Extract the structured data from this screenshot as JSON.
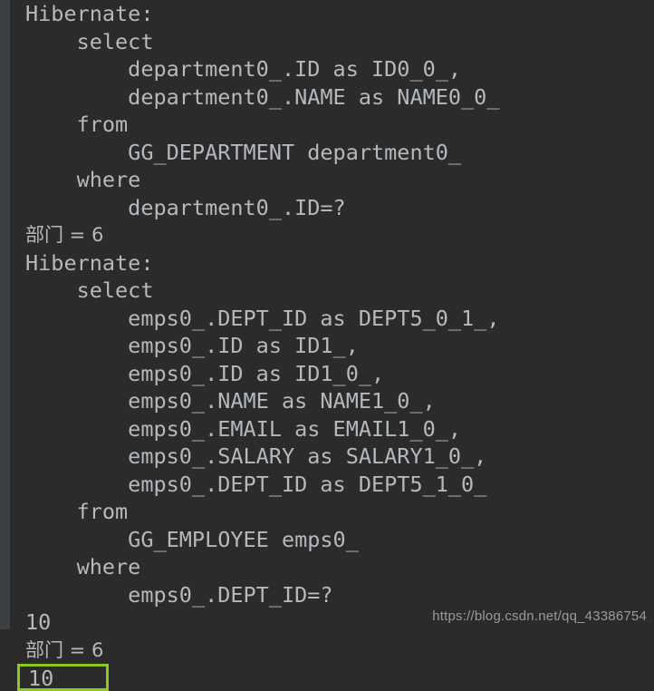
{
  "app": {
    "surface": "ide-console-output",
    "background_color": "#2b2b2b",
    "gutter_color": "#3c4043",
    "text_color": "#b4b9bd",
    "highlight_color": "#8cc81e"
  },
  "console": {
    "lines": [
      {
        "id": "line-1",
        "text": "Hibernate: ",
        "cjk": false,
        "highlighted": false
      },
      {
        "id": "line-2",
        "text": "    select",
        "cjk": false,
        "highlighted": false
      },
      {
        "id": "line-3",
        "text": "        department0_.ID as ID0_0_,",
        "cjk": false,
        "highlighted": false
      },
      {
        "id": "line-4",
        "text": "        department0_.NAME as NAME0_0_",
        "cjk": false,
        "highlighted": false
      },
      {
        "id": "line-5",
        "text": "    from",
        "cjk": false,
        "highlighted": false
      },
      {
        "id": "line-6",
        "text": "        GG_DEPARTMENT department0_",
        "cjk": false,
        "highlighted": false
      },
      {
        "id": "line-7",
        "text": "    where",
        "cjk": false,
        "highlighted": false
      },
      {
        "id": "line-8",
        "text": "        department0_.ID=?",
        "cjk": false,
        "highlighted": false
      },
      {
        "id": "line-9",
        "text": "部门 = 6",
        "cjk": true,
        "highlighted": false
      },
      {
        "id": "line-10",
        "text": "Hibernate: ",
        "cjk": false,
        "highlighted": false
      },
      {
        "id": "line-11",
        "text": "    select",
        "cjk": false,
        "highlighted": false
      },
      {
        "id": "line-12",
        "text": "        emps0_.DEPT_ID as DEPT5_0_1_,",
        "cjk": false,
        "highlighted": false
      },
      {
        "id": "line-13",
        "text": "        emps0_.ID as ID1_,",
        "cjk": false,
        "highlighted": false
      },
      {
        "id": "line-14",
        "text": "        emps0_.ID as ID1_0_,",
        "cjk": false,
        "highlighted": false
      },
      {
        "id": "line-15",
        "text": "        emps0_.NAME as NAME1_0_,",
        "cjk": false,
        "highlighted": false
      },
      {
        "id": "line-16",
        "text": "        emps0_.EMAIL as EMAIL1_0_,",
        "cjk": false,
        "highlighted": false
      },
      {
        "id": "line-17",
        "text": "        emps0_.SALARY as SALARY1_0_,",
        "cjk": false,
        "highlighted": false
      },
      {
        "id": "line-18",
        "text": "        emps0_.DEPT_ID as DEPT5_1_0_",
        "cjk": false,
        "highlighted": false
      },
      {
        "id": "line-19",
        "text": "    from",
        "cjk": false,
        "highlighted": false
      },
      {
        "id": "line-20",
        "text": "        GG_EMPLOYEE emps0_",
        "cjk": false,
        "highlighted": false
      },
      {
        "id": "line-21",
        "text": "    where",
        "cjk": false,
        "highlighted": false
      },
      {
        "id": "line-22",
        "text": "        emps0_.DEPT_ID=?",
        "cjk": false,
        "highlighted": false
      },
      {
        "id": "line-23",
        "text": "10",
        "cjk": false,
        "highlighted": false
      },
      {
        "id": "line-24",
        "text": "部门 = 6",
        "cjk": true,
        "highlighted": false
      },
      {
        "id": "line-25",
        "text": "10",
        "cjk": false,
        "highlighted": true
      }
    ]
  },
  "watermark": {
    "text": "https://blog.csdn.net/qq_43386754"
  }
}
